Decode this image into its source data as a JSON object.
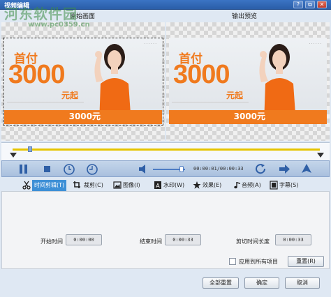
{
  "window": {
    "title": "视频编辑",
    "buttons": [
      "?",
      "⧉",
      "✕"
    ]
  },
  "watermark": {
    "text": "河东软件园",
    "url": "www.pc0359.cn"
  },
  "panels": {
    "original_label": "原始画面",
    "output_label": "输出预览"
  },
  "ad": {
    "headline": "首付",
    "amount": "3000",
    "suffix": "元起",
    "price_strip": "3000元"
  },
  "player": {
    "timecode": "00:00:01/00:00:33",
    "volume_level": 0.9
  },
  "tabs": [
    {
      "label": "时间剪辑(T)",
      "icon": "scissors-icon",
      "active": true
    },
    {
      "label": "裁剪(C)",
      "icon": "crop-icon",
      "active": false
    },
    {
      "label": "图像(I)",
      "icon": "image-icon",
      "active": false
    },
    {
      "label": "水印(W)",
      "icon": "watermark-icon",
      "active": false
    },
    {
      "label": "效果(E)",
      "icon": "star-icon",
      "active": false
    },
    {
      "label": "音频(A)",
      "icon": "music-note-icon",
      "active": false
    },
    {
      "label": "字幕(S)",
      "icon": "subtitle-icon",
      "active": false
    }
  ],
  "time_edit": {
    "start_label": "开始时间",
    "start_value": "0:00:00",
    "end_label": "结束时间",
    "end_value": "0:00:33",
    "duration_label": "剪切时间长度",
    "duration_value": "0:00:33",
    "apply_all_label": "应用到所有项目",
    "reset_label": "重置(R)"
  },
  "footer": {
    "reset_all_label": "全部重置",
    "ok_label": "确定",
    "cancel_label": "取消"
  },
  "colors": {
    "accent": "#3d8fd6",
    "ad_orange": "#f07a1e",
    "timeline_track": "#e5c400"
  }
}
